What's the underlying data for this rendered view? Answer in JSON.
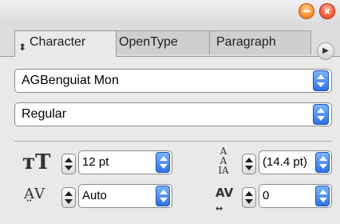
{
  "panel": {
    "tabs": [
      {
        "label": "Character",
        "active": true
      },
      {
        "label": "OpenType",
        "active": false
      },
      {
        "label": "Paragraph",
        "active": false
      }
    ]
  },
  "character": {
    "font_family": "AGBenguiat Mon",
    "font_style": "Regular",
    "font_size": "12 pt",
    "leading": "(14.4 pt)",
    "kerning": "Auto",
    "tracking": "0"
  },
  "colors": {
    "accent": "#2d6fe0",
    "minimize": "#ff9a3c",
    "close": "#ff6a48"
  }
}
